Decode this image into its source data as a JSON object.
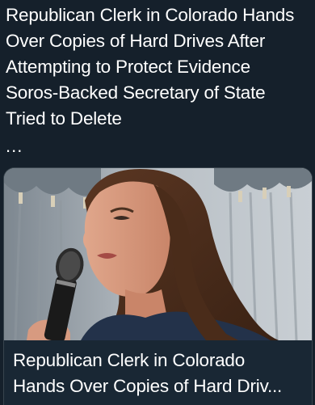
{
  "tweet": {
    "lines": [
      "Republican Clerk in Colorado Hands",
      "Over Copies of Hard Drives After",
      "Attempting to Protect Evidence",
      "Soros-Backed Secretary of State",
      "Tried to Delete"
    ],
    "truncation": "..."
  },
  "card": {
    "image_icon": "photo-of-woman-speaking-into-microphone",
    "title_lines": [
      "Republican Clerk in Colorado",
      "Hands Over Copies of Hard Driv..."
    ]
  },
  "colors": {
    "background": "#15202b",
    "text": "#ffffff",
    "card_border": "#38444d"
  }
}
